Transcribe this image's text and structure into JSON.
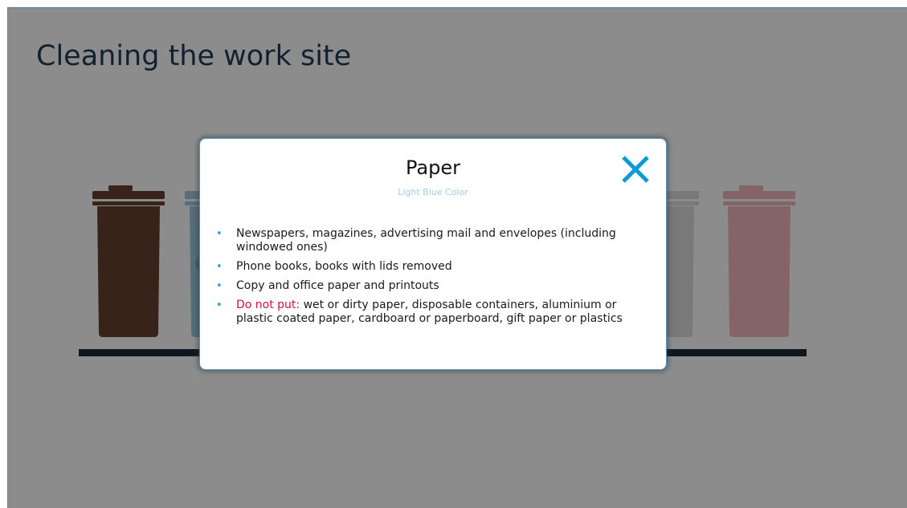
{
  "slide": {
    "title": "Cleaning the work site"
  },
  "bins": [
    {
      "name": "brown",
      "color": "#64412e"
    },
    {
      "name": "light-blue",
      "color": "#9ec6dc"
    },
    {
      "name": "gray",
      "color": "#dcdcdc"
    },
    {
      "name": "pink",
      "color": "#f2b7bd"
    }
  ],
  "modal": {
    "title": "Paper",
    "subtitle": "Light Blue Color",
    "close_icon": "close-x-icon",
    "accent_color": "#0b9ad8",
    "warning_color": "#d0103a",
    "items": [
      {
        "text": "Newspapers, magazines, advertising mail and envelopes (including windowed ones)"
      },
      {
        "text": "Phone books, books with lids removed"
      },
      {
        "text": "Copy and office paper and printouts"
      }
    ],
    "warning_item": {
      "label": "Do not put:",
      "text": " wet or dirty paper, disposable containers, aluminium or plastic coated paper, cardboard or paperboard, gift paper or plastics"
    }
  }
}
